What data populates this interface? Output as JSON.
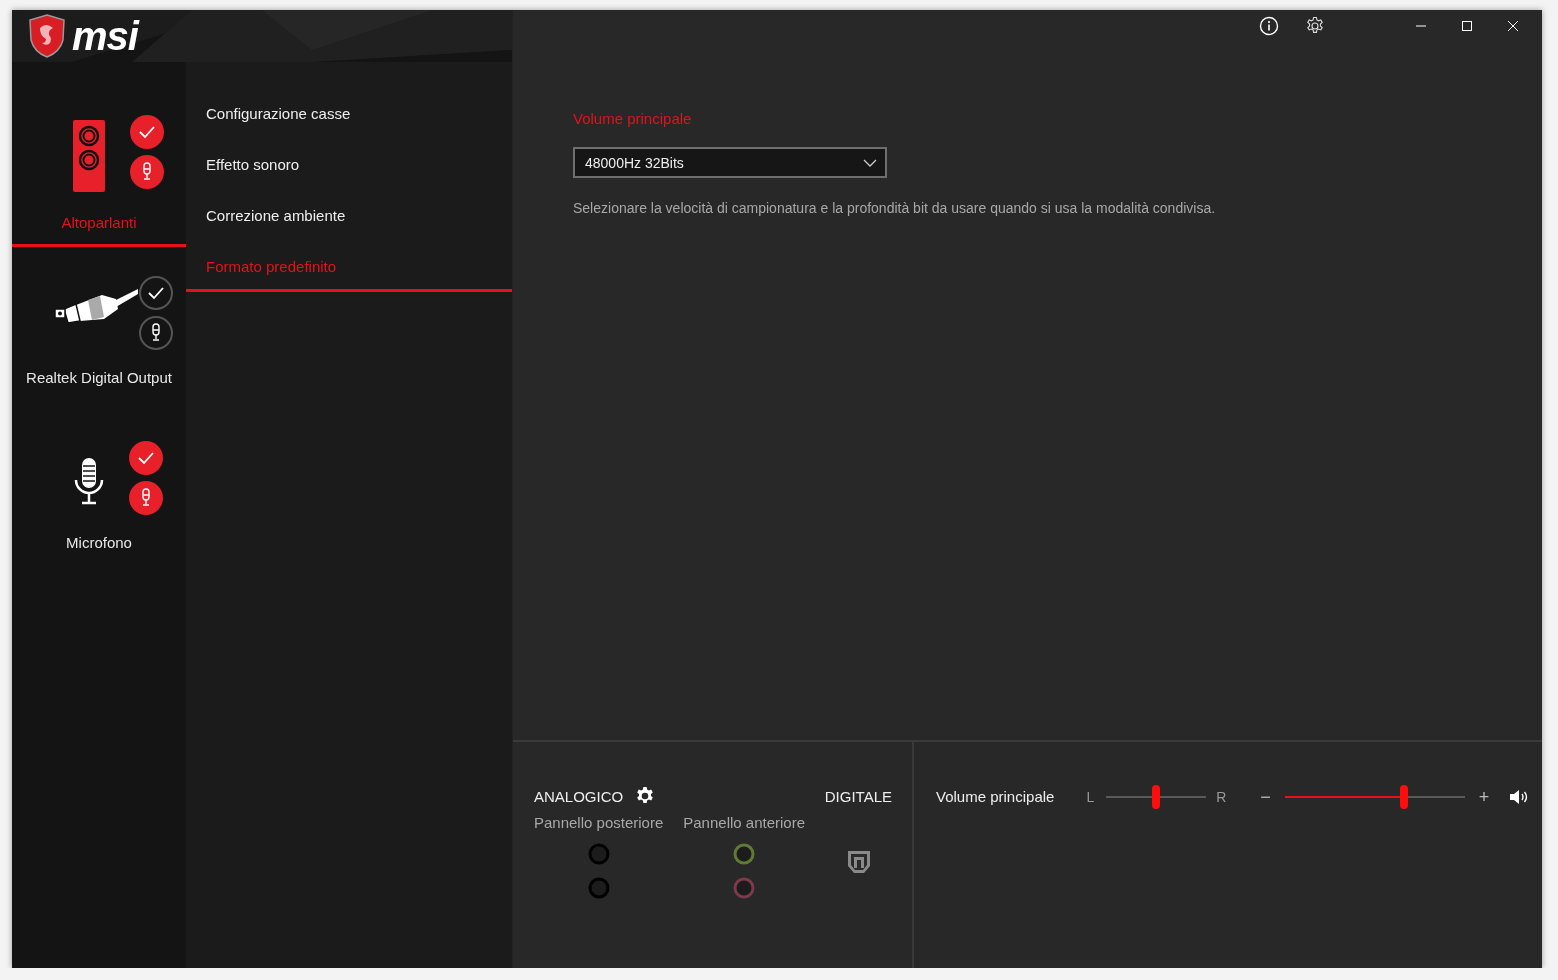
{
  "app": {
    "logo": "msi"
  },
  "devices": [
    {
      "kind": "speaker",
      "name": "Altoparlanti",
      "selected": true,
      "default": true
    },
    {
      "kind": "optical",
      "name": "Realtek Digital Output",
      "selected": false,
      "default": false
    },
    {
      "kind": "mic",
      "name": "Microfono",
      "selected": false,
      "default": true
    }
  ],
  "menu": [
    {
      "label": "Configurazione casse",
      "selected": false
    },
    {
      "label": "Effetto sonoro",
      "selected": false
    },
    {
      "label": "Correzione ambiente",
      "selected": false
    },
    {
      "label": "Formato predefinito",
      "selected": true
    }
  ],
  "content": {
    "section_title": "Volume principale",
    "sample_format": {
      "value": "48000Hz 32Bits"
    },
    "description": "Selezionare la velocità di campionatura e la profondità bit da usare quando si usa la modalità condivisa."
  },
  "connectors": {
    "analog": {
      "label": "ANALOGICO",
      "groups": [
        {
          "label": "Pannello posteriore",
          "jacks": [
            {
              "color": "#000000"
            },
            {
              "color": "#000000"
            }
          ]
        },
        {
          "label": "Pannello anteriore",
          "jacks": [
            {
              "color": "#5f7a34"
            },
            {
              "color": "#7a3a4b"
            }
          ]
        }
      ]
    },
    "digital": {
      "label": "DIGITALE"
    }
  },
  "volume": {
    "label": "Volume principale",
    "balance": {
      "left": "L",
      "right": "R",
      "level": 0.5
    },
    "master": {
      "minus": "−",
      "plus": "+",
      "level": 0.66
    }
  }
}
